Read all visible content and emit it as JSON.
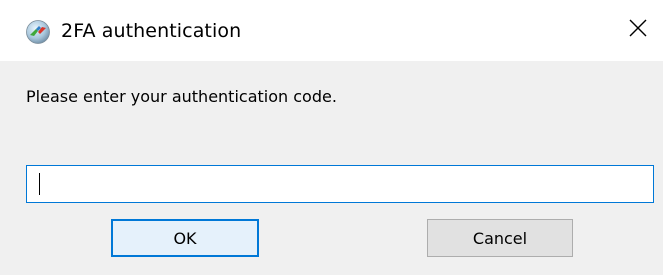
{
  "window": {
    "title": "2FA authentication",
    "icon": "remote-desktop-app-icon",
    "close_icon": "close-icon"
  },
  "dialog": {
    "prompt": "Please enter your authentication code.",
    "input": {
      "value": "",
      "placeholder": ""
    },
    "buttons": {
      "ok_label": "OK",
      "cancel_label": "Cancel"
    }
  },
  "colors": {
    "accent": "#0078d7",
    "body_background": "#f0f0f0",
    "button_background": "#e1e1e1",
    "button_border": "#adadad"
  }
}
